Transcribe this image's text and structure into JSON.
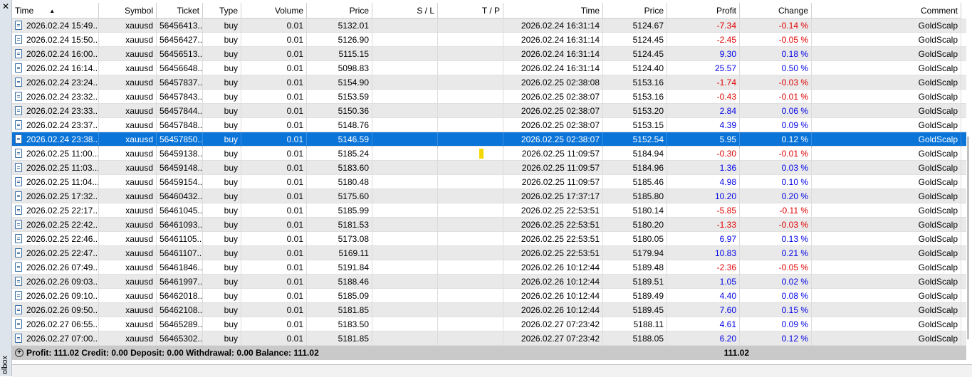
{
  "toolbox": {
    "close_symbol": "✕",
    "label": "olbox"
  },
  "columns": {
    "time": "Time",
    "symbol": "Symbol",
    "ticket": "Ticket",
    "type": "Type",
    "volume": "Volume",
    "price": "Price",
    "sl": "S / L",
    "tp": "T / P",
    "close_time": "Time",
    "close_price": "Price",
    "profit": "Profit",
    "change": "Change",
    "comment": "Comment"
  },
  "sort_indicator": "▲",
  "rows": [
    {
      "time": "2026.02.24 15:49...",
      "symbol": "xauusd",
      "ticket": "56456413...",
      "type": "buy",
      "volume": "0.01",
      "price": "5132.01",
      "close_time": "2026.02.24 16:31:14",
      "close_price": "5124.67",
      "profit": "-7.34",
      "change": "-0.14 %",
      "comment": "GoldScalp"
    },
    {
      "time": "2026.02.24 15:50...",
      "symbol": "xauusd",
      "ticket": "56456427...",
      "type": "buy",
      "volume": "0.01",
      "price": "5126.90",
      "close_time": "2026.02.24 16:31:14",
      "close_price": "5124.45",
      "profit": "-2.45",
      "change": "-0.05 %",
      "comment": "GoldScalp"
    },
    {
      "time": "2026.02.24 16:00...",
      "symbol": "xauusd",
      "ticket": "56456513...",
      "type": "buy",
      "volume": "0.01",
      "price": "5115.15",
      "close_time": "2026.02.24 16:31:14",
      "close_price": "5124.45",
      "profit": "9.30",
      "change": "0.18 %",
      "comment": "GoldScalp"
    },
    {
      "time": "2026.02.24 16:14...",
      "symbol": "xauusd",
      "ticket": "56456648...",
      "type": "buy",
      "volume": "0.01",
      "price": "5098.83",
      "close_time": "2026.02.24 16:31:14",
      "close_price": "5124.40",
      "profit": "25.57",
      "change": "0.50 %",
      "comment": "GoldScalp"
    },
    {
      "time": "2026.02.24 23:24...",
      "symbol": "xauusd",
      "ticket": "56457837...",
      "type": "buy",
      "volume": "0.01",
      "price": "5154.90",
      "close_time": "2026.02.25 02:38:08",
      "close_price": "5153.16",
      "profit": "-1.74",
      "change": "-0.03 %",
      "comment": "GoldScalp"
    },
    {
      "time": "2026.02.24 23:32...",
      "symbol": "xauusd",
      "ticket": "56457843...",
      "type": "buy",
      "volume": "0.01",
      "price": "5153.59",
      "close_time": "2026.02.25 02:38:07",
      "close_price": "5153.16",
      "profit": "-0.43",
      "change": "-0.01 %",
      "comment": "GoldScalp"
    },
    {
      "time": "2026.02.24 23:33...",
      "symbol": "xauusd",
      "ticket": "56457844...",
      "type": "buy",
      "volume": "0.01",
      "price": "5150.36",
      "close_time": "2026.02.25 02:38:07",
      "close_price": "5153.20",
      "profit": "2.84",
      "change": "0.06 %",
      "comment": "GoldScalp"
    },
    {
      "time": "2026.02.24 23:37...",
      "symbol": "xauusd",
      "ticket": "56457848...",
      "type": "buy",
      "volume": "0.01",
      "price": "5148.76",
      "close_time": "2026.02.25 02:38:07",
      "close_price": "5153.15",
      "profit": "4.39",
      "change": "0.09 %",
      "comment": "GoldScalp"
    },
    {
      "time": "2026.02.24 23:38...",
      "symbol": "xauusd",
      "ticket": "56457850...",
      "type": "buy",
      "volume": "0.01",
      "price": "5146.59",
      "close_time": "2026.02.25 02:38:07",
      "close_price": "5152.54",
      "profit": "5.95",
      "change": "0.12 %",
      "comment": "GoldScalp",
      "selected": true
    },
    {
      "time": "2026.02.25 11:00...",
      "symbol": "xauusd",
      "ticket": "56459138...",
      "type": "buy",
      "volume": "0.01",
      "price": "5185.24",
      "close_time": "2026.02.25 11:09:57",
      "close_price": "5184.94",
      "profit": "-0.30",
      "change": "-0.01 %",
      "comment": "GoldScalp"
    },
    {
      "time": "2026.02.25 11:03...",
      "symbol": "xauusd",
      "ticket": "56459148...",
      "type": "buy",
      "volume": "0.01",
      "price": "5183.60",
      "close_time": "2026.02.25 11:09:57",
      "close_price": "5184.96",
      "profit": "1.36",
      "change": "0.03 %",
      "comment": "GoldScalp"
    },
    {
      "time": "2026.02.25 11:04...",
      "symbol": "xauusd",
      "ticket": "56459154...",
      "type": "buy",
      "volume": "0.01",
      "price": "5180.48",
      "close_time": "2026.02.25 11:09:57",
      "close_price": "5185.46",
      "profit": "4.98",
      "change": "0.10 %",
      "comment": "GoldScalp"
    },
    {
      "time": "2026.02.25 17:32...",
      "symbol": "xauusd",
      "ticket": "56460432...",
      "type": "buy",
      "volume": "0.01",
      "price": "5175.60",
      "close_time": "2026.02.25 17:37:17",
      "close_price": "5185.80",
      "profit": "10.20",
      "change": "0.20 %",
      "comment": "GoldScalp"
    },
    {
      "time": "2026.02.25 22:17...",
      "symbol": "xauusd",
      "ticket": "56461045...",
      "type": "buy",
      "volume": "0.01",
      "price": "5185.99",
      "close_time": "2026.02.25 22:53:51",
      "close_price": "5180.14",
      "profit": "-5.85",
      "change": "-0.11 %",
      "comment": "GoldScalp"
    },
    {
      "time": "2026.02.25 22:42...",
      "symbol": "xauusd",
      "ticket": "56461093...",
      "type": "buy",
      "volume": "0.01",
      "price": "5181.53",
      "close_time": "2026.02.25 22:53:51",
      "close_price": "5180.20",
      "profit": "-1.33",
      "change": "-0.03 %",
      "comment": "GoldScalp"
    },
    {
      "time": "2026.02.25 22:46...",
      "symbol": "xauusd",
      "ticket": "56461105...",
      "type": "buy",
      "volume": "0.01",
      "price": "5173.08",
      "close_time": "2026.02.25 22:53:51",
      "close_price": "5180.05",
      "profit": "6.97",
      "change": "0.13 %",
      "comment": "GoldScalp"
    },
    {
      "time": "2026.02.25 22:47...",
      "symbol": "xauusd",
      "ticket": "56461107...",
      "type": "buy",
      "volume": "0.01",
      "price": "5169.11",
      "close_time": "2026.02.25 22:53:51",
      "close_price": "5179.94",
      "profit": "10.83",
      "change": "0.21 %",
      "comment": "GoldScalp"
    },
    {
      "time": "2026.02.26 07:49...",
      "symbol": "xauusd",
      "ticket": "56461846...",
      "type": "buy",
      "volume": "0.01",
      "price": "5191.84",
      "close_time": "2026.02.26 10:12:44",
      "close_price": "5189.48",
      "profit": "-2.36",
      "change": "-0.05 %",
      "comment": "GoldScalp"
    },
    {
      "time": "2026.02.26 09:03...",
      "symbol": "xauusd",
      "ticket": "56461997...",
      "type": "buy",
      "volume": "0.01",
      "price": "5188.46",
      "close_time": "2026.02.26 10:12:44",
      "close_price": "5189.51",
      "profit": "1.05",
      "change": "0.02 %",
      "comment": "GoldScalp"
    },
    {
      "time": "2026.02.26 09:10...",
      "symbol": "xauusd",
      "ticket": "56462018...",
      "type": "buy",
      "volume": "0.01",
      "price": "5185.09",
      "close_time": "2026.02.26 10:12:44",
      "close_price": "5189.49",
      "profit": "4.40",
      "change": "0.08 %",
      "comment": "GoldScalp"
    },
    {
      "time": "2026.02.26 09:50...",
      "symbol": "xauusd",
      "ticket": "56462108...",
      "type": "buy",
      "volume": "0.01",
      "price": "5181.85",
      "close_time": "2026.02.26 10:12:44",
      "close_price": "5189.45",
      "profit": "7.60",
      "change": "0.15 %",
      "comment": "GoldScalp"
    },
    {
      "time": "2026.02.27 06:55...",
      "symbol": "xauusd",
      "ticket": "56465289...",
      "type": "buy",
      "volume": "0.01",
      "price": "5183.50",
      "close_time": "2026.02.27 07:23:42",
      "close_price": "5188.11",
      "profit": "4.61",
      "change": "0.09 %",
      "comment": "GoldScalp"
    },
    {
      "time": "2026.02.27 07:00...",
      "symbol": "xauusd",
      "ticket": "56465302...",
      "type": "buy",
      "volume": "0.01",
      "price": "5181.85",
      "close_time": "2026.02.27 07:23:42",
      "close_price": "5188.05",
      "profit": "6.20",
      "change": "0.12 %",
      "comment": "GoldScalp"
    }
  ],
  "summary": {
    "text": "Profit: 111.02  Credit: 0.00  Deposit: 0.00  Withdrawal: 0.00  Balance: 111.02",
    "total_profit": "111.02"
  },
  "colors": {
    "selected": "#0a74d9",
    "negative": "#e00000",
    "positive": "#0000e6",
    "tp_marker": "#f5d800"
  }
}
